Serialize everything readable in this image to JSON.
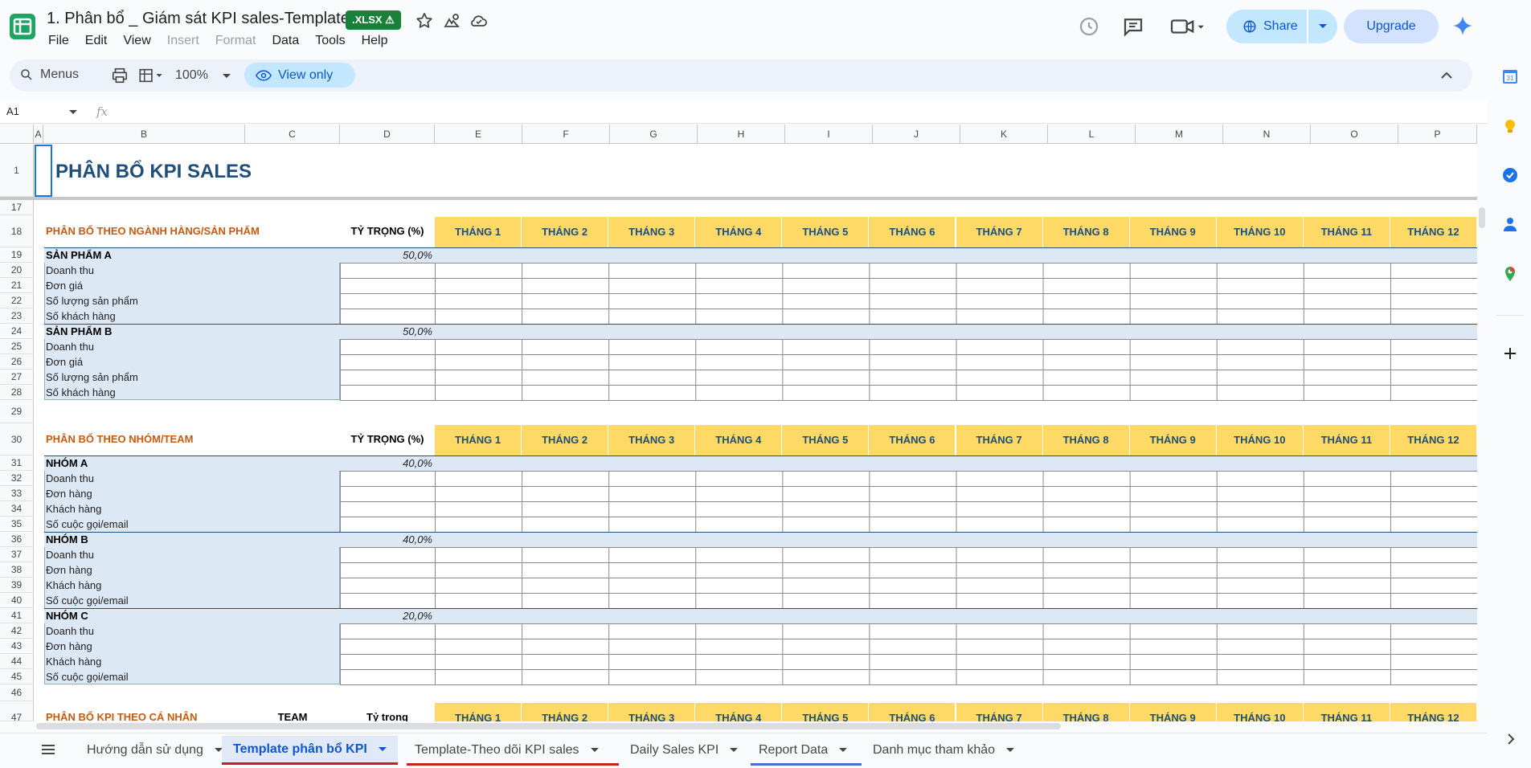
{
  "window": {
    "title": "1. Phân bổ _ Giám sát KPI sales-Template",
    "badge": ".XLSX ⚠"
  },
  "menu": [
    "File",
    "Edit",
    "View",
    "Insert",
    "Format",
    "Data",
    "Tools",
    "Help"
  ],
  "header_actions": {
    "share_label": "Share",
    "upgrade_label": "Upgrade"
  },
  "toolbar": {
    "menus_label": "Menus",
    "zoom": "100%",
    "view_only_label": "View only"
  },
  "formula_bar": {
    "name_box": "A1",
    "fx": "fx"
  },
  "columns": [
    "A",
    "B",
    "C",
    "D",
    "E",
    "F",
    "G",
    "H",
    "I",
    "J",
    "K",
    "L",
    "M",
    "N",
    "O",
    "P"
  ],
  "rows": [
    "1",
    "17",
    "18",
    "19",
    "20",
    "21",
    "22",
    "23",
    "24",
    "25",
    "26",
    "27",
    "28",
    "29",
    "30",
    "31",
    "32",
    "33",
    "34",
    "35",
    "36",
    "37",
    "38",
    "39",
    "40",
    "41",
    "42",
    "43",
    "44",
    "45",
    "46",
    "47"
  ],
  "sheet": {
    "title": "PHÂN BỔ KPI SALES",
    "months": [
      "THÁNG 1",
      "THÁNG 2",
      "THÁNG 3",
      "THÁNG 4",
      "THÁNG 5",
      "THÁNG 6",
      "THÁNG 7",
      "THÁNG 8",
      "THÁNG 9",
      "THÁNG 10",
      "THÁNG 11",
      "THÁNG 12"
    ],
    "section1": {
      "title": "PHÂN BỔ THEO NGÀNH HÀNG/SẢN PHẨM",
      "ratio_header": "TỶ TRỌNG (%)",
      "groups": [
        {
          "name": "SẢN PHẨM A",
          "ratio": "50,0%",
          "items": [
            "Doanh thu",
            "Đơn giá",
            "Số lượng sản phẩm",
            "Số khách hàng"
          ]
        },
        {
          "name": "SẢN PHẨM B",
          "ratio": "50,0%",
          "items": [
            "Doanh thu",
            "Đơn giá",
            "Số lượng sản phẩm",
            "Số khách hàng"
          ]
        }
      ]
    },
    "section2": {
      "title": "PHÂN BỔ THEO NHÓM/TEAM",
      "ratio_header": "TỶ TRỌNG (%)",
      "groups": [
        {
          "name": "NHÓM A",
          "ratio": "40,0%",
          "items": [
            "Doanh thu",
            "Đơn hàng",
            "Khách hàng",
            "Số cuộc gọi/email"
          ]
        },
        {
          "name": "NHÓM B",
          "ratio": "40,0%",
          "items": [
            "Doanh thu",
            "Đơn hàng",
            "Khách hàng",
            "Số cuộc gọi/email"
          ]
        },
        {
          "name": "NHÓM C",
          "ratio": "20,0%",
          "items": [
            "Doanh thu",
            "Đơn hàng",
            "Khách hàng",
            "Số cuộc gọi/email"
          ]
        }
      ]
    },
    "section3": {
      "title": "PHÂN BỔ KPI THEO CÁ NHÂN",
      "team_header": "TEAM",
      "ratio_header": "Tỷ trọng"
    }
  },
  "tabs": [
    {
      "label": "Hướng dẫn sử dụng",
      "active": false,
      "color": ""
    },
    {
      "label": "Template phân bổ KPI",
      "active": true,
      "color": "#c5221f"
    },
    {
      "label": "Template-Theo dõi KPI sales",
      "active": false,
      "color": "#c5221f"
    },
    {
      "label": "Daily Sales KPI",
      "active": false,
      "color": ""
    },
    {
      "label": "Report Data",
      "active": false,
      "color": "#4472c4"
    },
    {
      "label": "Danh mục tham khảo",
      "active": false,
      "color": ""
    }
  ],
  "colors": {
    "month_header_bg": "#ffd966",
    "month_header_text": "#1f4e79",
    "section_title": "#c55a11",
    "label_bg": "#dde8f5",
    "accent": "#0b57d0"
  }
}
